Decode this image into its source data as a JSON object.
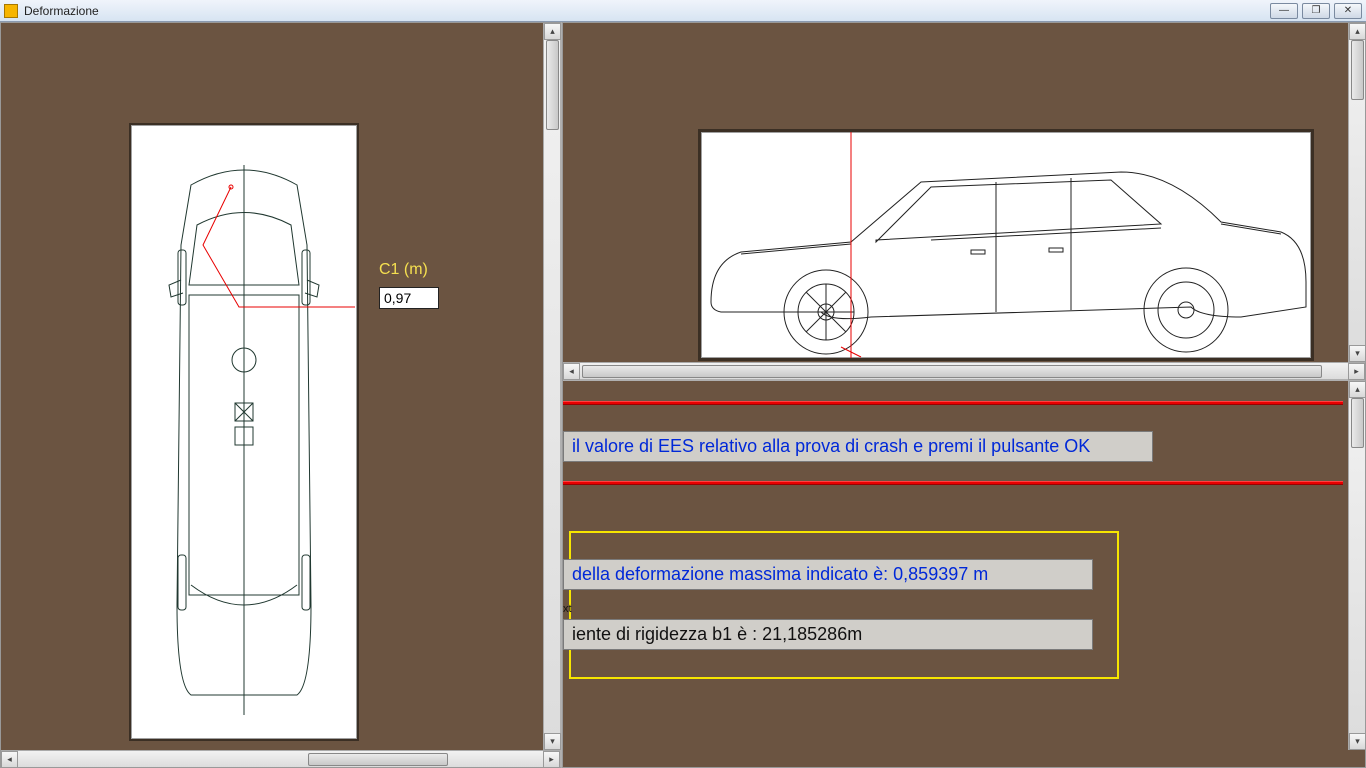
{
  "window": {
    "title": "Deformazione"
  },
  "leftPanel": {
    "c1_label": "C1 (m)",
    "c1_value": "0,97"
  },
  "messages": {
    "ees_prompt": "il valore di EES relativo alla prova di crash  e premi il pulsante OK",
    "deformation_max": "della deformazione massima indicato è: 0,859397 m",
    "rigidity_b1": "iente di rigidezza b1 è :  21,185286m",
    "xt_label": "xt"
  }
}
